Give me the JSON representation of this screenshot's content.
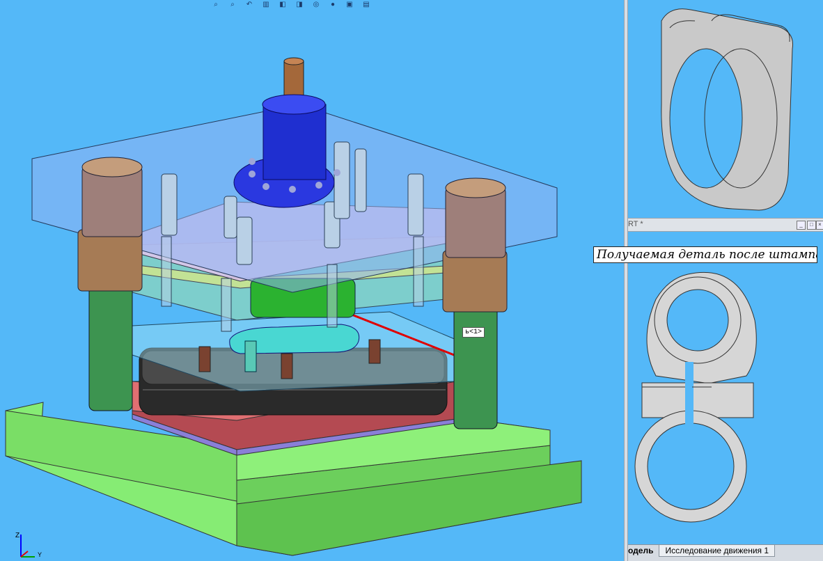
{
  "toolbar": {
    "icons": [
      "zoom-to-fit-icon",
      "zoom-area-icon",
      "previous-view-icon",
      "section-view-icon",
      "view-orientation-icon",
      "display-style-icon",
      "hide-show-items-icon",
      "edit-appearance-icon",
      "apply-scene-icon",
      "view-settings-icon"
    ]
  },
  "main_view": {
    "callout_text": "ь<1>",
    "triad": {
      "z_label": "Z",
      "y_label": "Y"
    }
  },
  "second_window": {
    "title": "RT *"
  },
  "caption": "Получаемая деталь после штампа",
  "tabs": [
    {
      "label": "одель",
      "active": true
    },
    {
      "label": "Исследование движения 1",
      "active": false
    }
  ],
  "colors": {
    "viewport_background": "#54b8f8",
    "base_plate": "#8ef07a",
    "guide_pillar": "#3e9a52",
    "bushing": "#a27752",
    "punch_holder": "#1e2bd0",
    "die_block": "#2c2c2c",
    "part": "#d8d8d8"
  }
}
